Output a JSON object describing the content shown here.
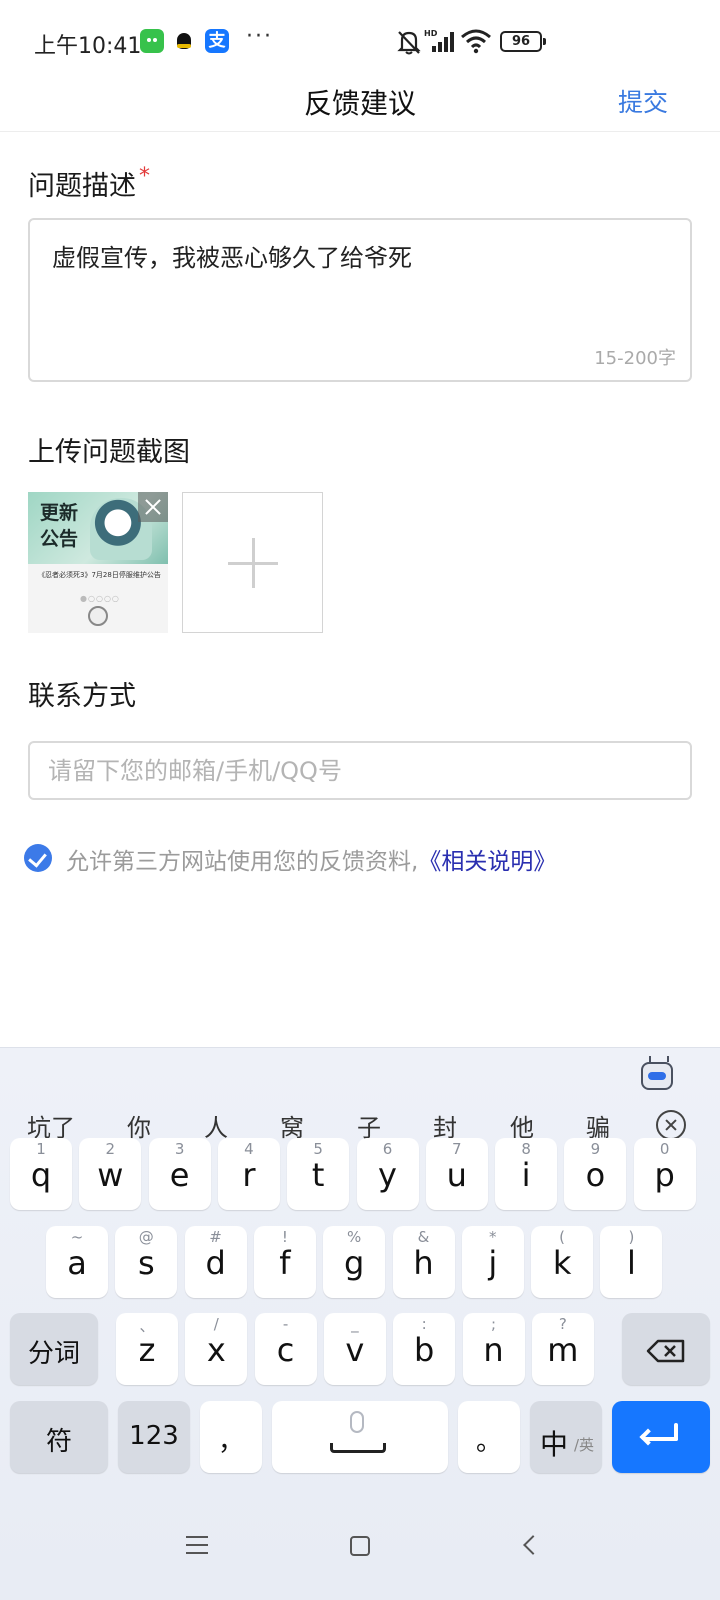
{
  "status_bar": {
    "time": "上午10:41",
    "app_icons": [
      "wechat-icon",
      "qq-icon",
      "alipay-icon"
    ],
    "alipay_glyph": "支",
    "more": "···",
    "battery": "96"
  },
  "header": {
    "title": "反馈建议",
    "submit_label": "提交"
  },
  "form": {
    "description_label": "问题描述",
    "required_mark": "*",
    "description_value": "虚假宣传，我被恶心够久了给爷死",
    "description_counter": "15-200字",
    "screenshot_label": "上传问题截图",
    "screenshot_thumb": {
      "art_text": "更新公告",
      "caption": "《忍者必须死3》7月28日停服维护公告",
      "dots": "●○○○○"
    },
    "contact_label": "联系方式",
    "contact_placeholder": "请留下您的邮箱/手机/QQ号",
    "consent_text": "允许第三方网站使用您的反馈资料,",
    "consent_link": "《相关说明》",
    "consent_checked": true
  },
  "keyboard": {
    "candidates": [
      "坑了",
      "你",
      "人",
      "窝",
      "子",
      "封",
      "他",
      "骗"
    ],
    "row1": [
      {
        "hint": "1",
        "key": "q"
      },
      {
        "hint": "2",
        "key": "w"
      },
      {
        "hint": "3",
        "key": "e"
      },
      {
        "hint": "4",
        "key": "r"
      },
      {
        "hint": "5",
        "key": "t"
      },
      {
        "hint": "6",
        "key": "y"
      },
      {
        "hint": "7",
        "key": "u"
      },
      {
        "hint": "8",
        "key": "i"
      },
      {
        "hint": "9",
        "key": "o"
      },
      {
        "hint": "0",
        "key": "p"
      }
    ],
    "row2": [
      {
        "hint": "~",
        "key": "a"
      },
      {
        "hint": "@",
        "key": "s"
      },
      {
        "hint": "#",
        "key": "d"
      },
      {
        "hint": "!",
        "key": "f"
      },
      {
        "hint": "%",
        "key": "g"
      },
      {
        "hint": "&",
        "key": "h"
      },
      {
        "hint": "*",
        "key": "j"
      },
      {
        "hint": "(",
        "key": "k"
      },
      {
        "hint": ")",
        "key": "l"
      }
    ],
    "row3": [
      {
        "hint": "、",
        "key": "z"
      },
      {
        "hint": "/",
        "key": "x"
      },
      {
        "hint": "-",
        "key": "c"
      },
      {
        "hint": "_",
        "key": "v"
      },
      {
        "hint": ":",
        "key": "b"
      },
      {
        "hint": ";",
        "key": "n"
      },
      {
        "hint": "?",
        "key": "m"
      }
    ],
    "segment_label": "分词",
    "symbol_label": "符",
    "numeric_label": "123",
    "comma_label": "，",
    "period_label": "。",
    "lang_main": "中",
    "lang_sub": "/英"
  },
  "colors": {
    "accent": "#3a7ae0",
    "enter_key": "#1677ff",
    "required": "#e23a3a",
    "link": "#2a2fb0"
  }
}
